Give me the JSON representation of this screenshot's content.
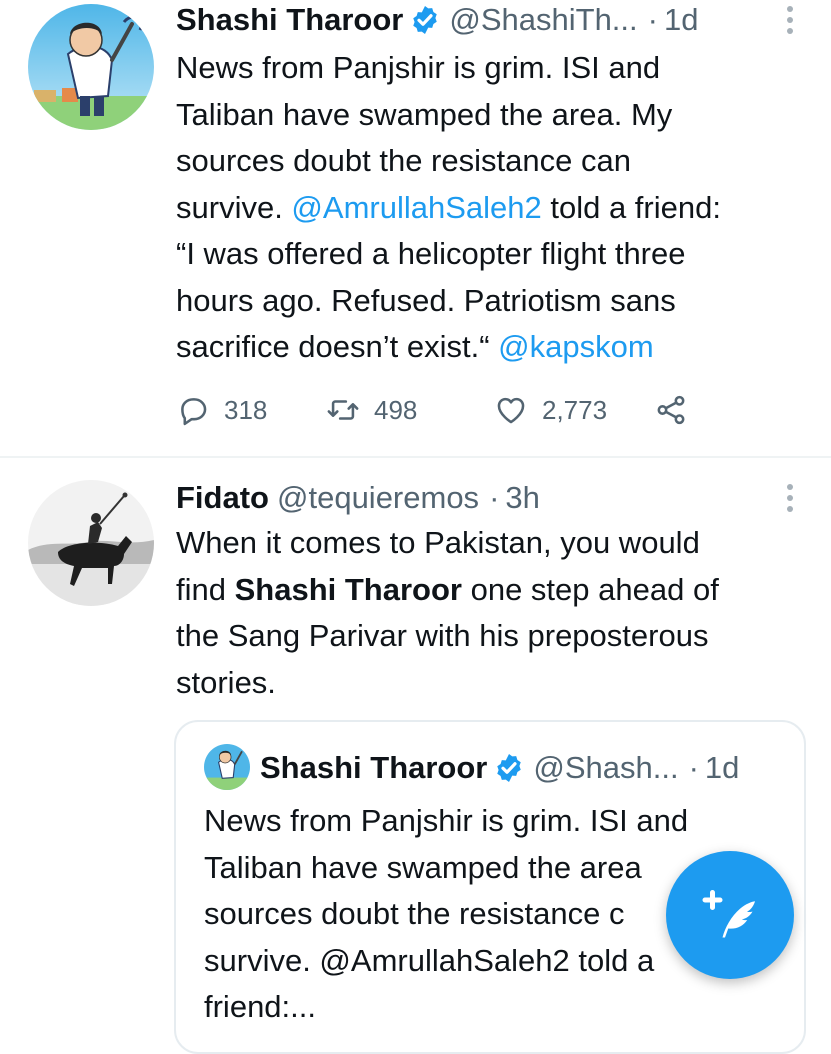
{
  "tweets": [
    {
      "author": "Shashi Tharoor",
      "handle": "@ShashiTh...",
      "time": "1d",
      "text_lines": [
        [
          "News from Panjshir is grim. ISI and"
        ],
        [
          "Taliban have swamped the area. My"
        ],
        [
          "sources doubt the resistance can"
        ],
        [
          "survive. ",
          "@AmrullahSaleh2",
          " told a friend:"
        ],
        [
          "“I was offered a helicopter flight three"
        ],
        [
          "hours ago. Refused. Patriotism sans"
        ],
        [
          "sacrifice doesn’t exist.“ ",
          "@kapskom"
        ]
      ],
      "replies": "318",
      "retweets": "498",
      "likes": "2,773"
    },
    {
      "author": "Fidato",
      "handle": "@tequieremos",
      "time": "3h",
      "text_lines": [
        [
          "When it comes to Pakistan, you would"
        ],
        [
          "find ",
          "Shashi Tharoor",
          " one step ahead of"
        ],
        [
          "the Sang Parivar with his preposterous"
        ],
        [
          "stories."
        ]
      ],
      "quoted": {
        "author": "Shashi Tharoor",
        "handle": "@Shash...",
        "time": "1d",
        "text_lines": [
          "News from Panjshir is grim. ISI and",
          "Taliban have swamped the area",
          "sources doubt the resistance c",
          "survive. @AmrullahSaleh2 told a",
          "friend:..."
        ]
      }
    }
  ],
  "separator": "·",
  "icons": {
    "verified": "verified-badge-icon",
    "more": "more-vertical-icon",
    "reply": "reply-icon",
    "retweet": "retweet-icon",
    "like": "heart-icon",
    "share": "share-icon",
    "compose": "compose-tweet-icon"
  },
  "colors": {
    "accent": "#1d9bf0",
    "text": "#0f1419",
    "muted": "#536471",
    "border": "#e6ecf0"
  }
}
